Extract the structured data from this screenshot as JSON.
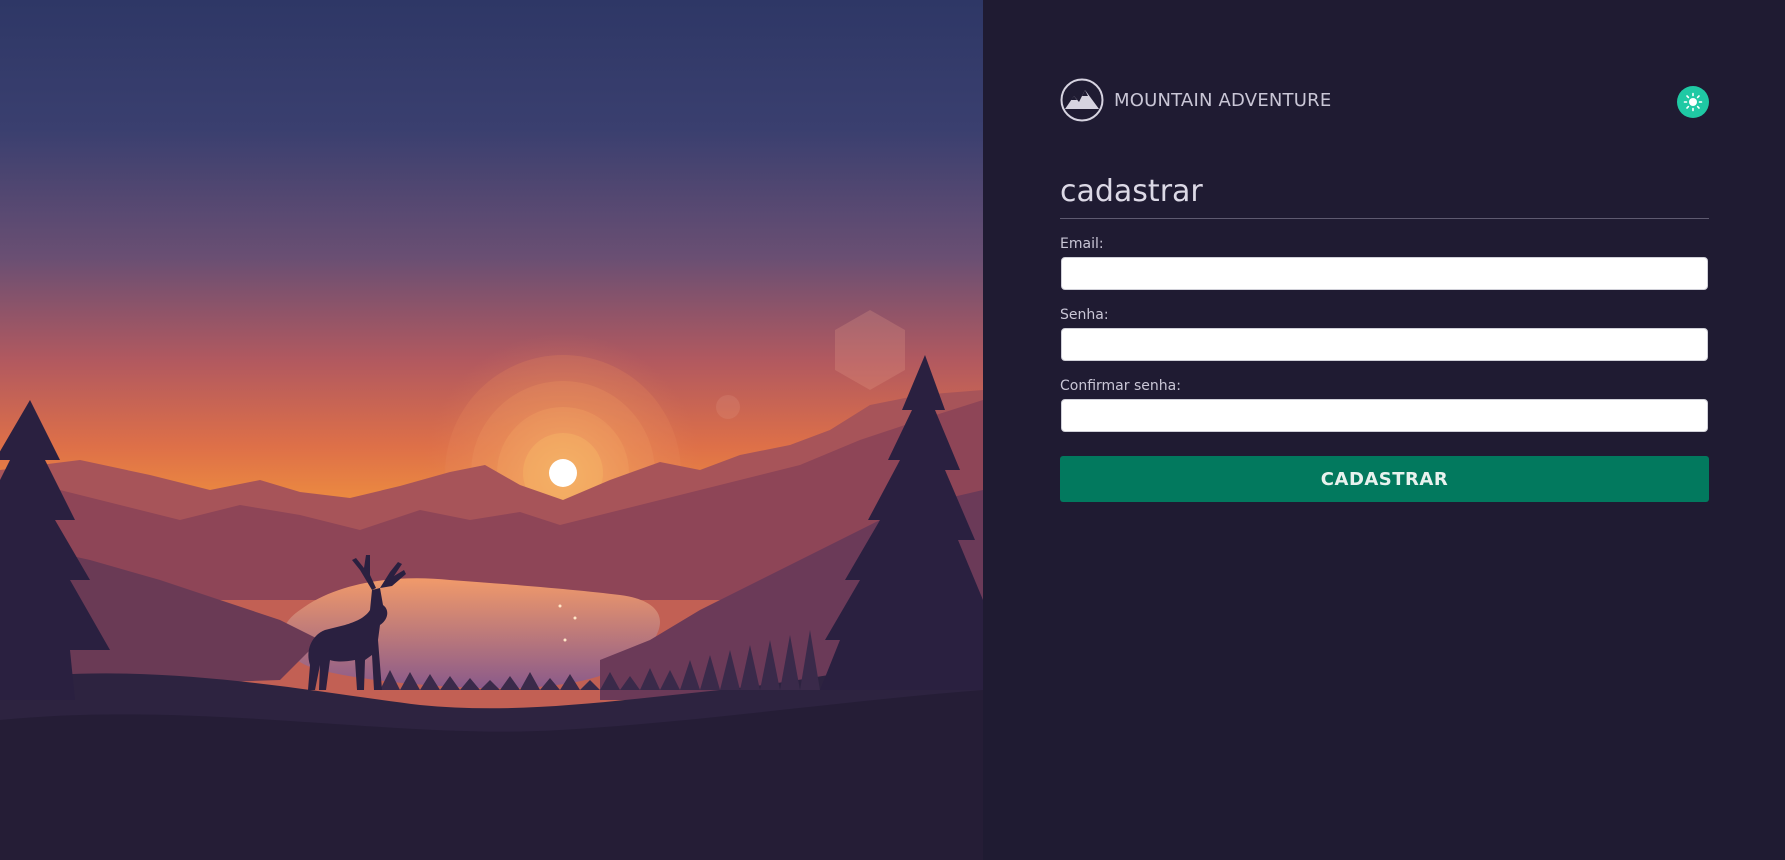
{
  "brand": {
    "name": "MOUNTAIN ADVENTURE",
    "logo_icon": "mountain-logo-icon"
  },
  "theme_toggle": {
    "icon": "sun-icon",
    "color": "#1fc9a4"
  },
  "form": {
    "title": "cadastrar",
    "fields": [
      {
        "label": "Email:",
        "value": "",
        "placeholder": ""
      },
      {
        "label": "Senha:",
        "value": "",
        "placeholder": ""
      },
      {
        "label": "Confirmar senha:",
        "value": "",
        "placeholder": ""
      }
    ],
    "submit_label": "CADASTRAR"
  },
  "colors": {
    "panel_background": "#1f1b32",
    "button": "#02795e",
    "accent": "#1fc9a4"
  }
}
